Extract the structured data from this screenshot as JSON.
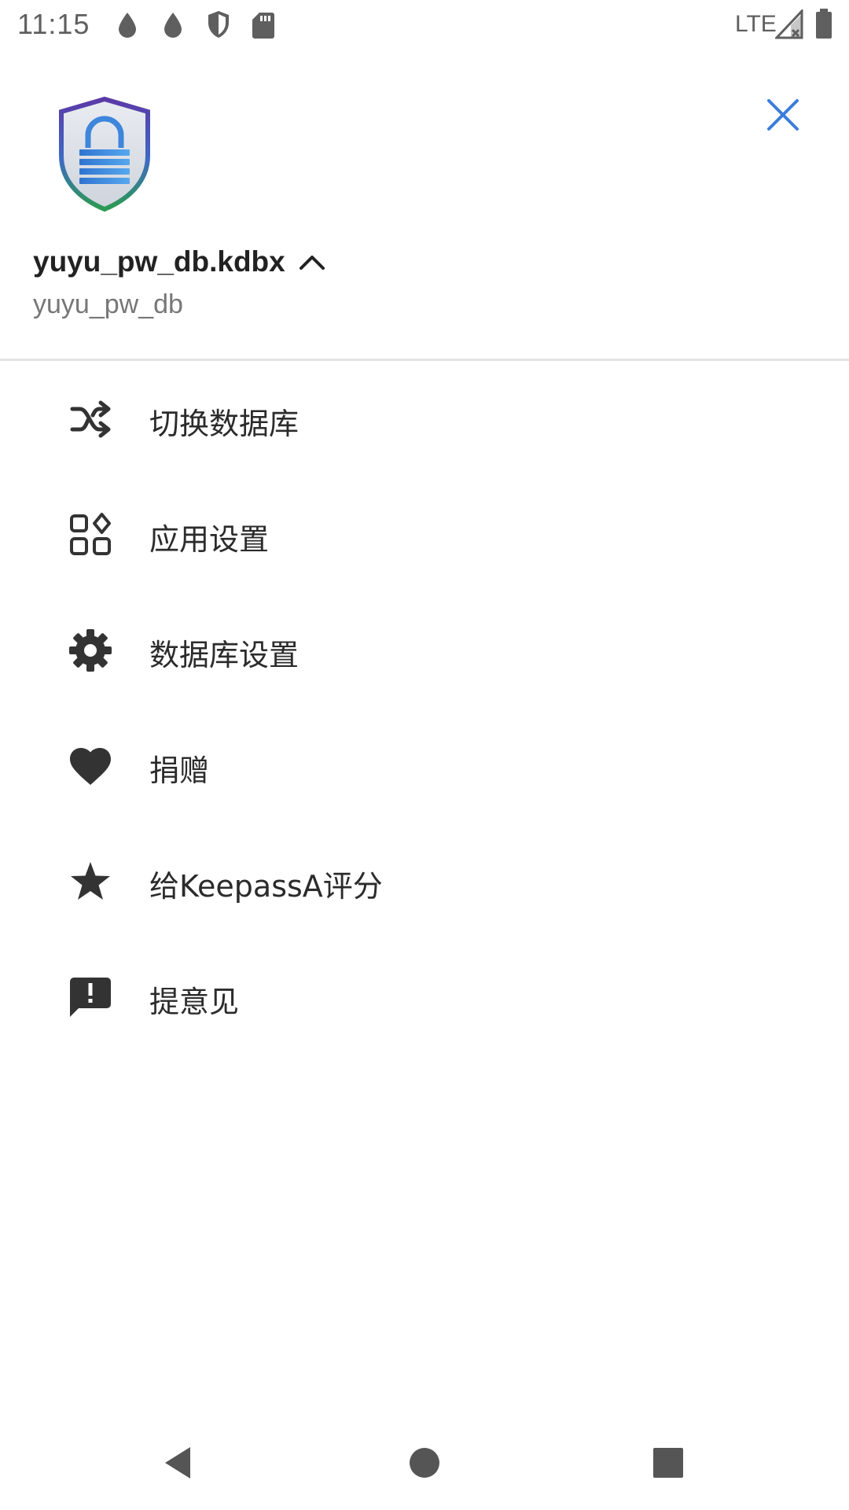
{
  "status_bar": {
    "time": "11:15",
    "network": "LTE",
    "icons": [
      "drop-icon",
      "drop-icon",
      "shield-icon",
      "sd-card-icon",
      "signal-icon",
      "battery-icon"
    ]
  },
  "header": {
    "logo": "keepassa-shield-lock-logo",
    "close_icon": "close-icon",
    "close_color": "#3b7ddd",
    "database_file": "yuyu_pw_db.kdbx",
    "expand_icon": "chevron-up-icon",
    "database_name": "yuyu_pw_db"
  },
  "menu": {
    "items": [
      {
        "icon": "shuffle-icon",
        "label": "切换数据库"
      },
      {
        "icon": "apps-icon",
        "label": "应用设置"
      },
      {
        "icon": "gear-icon",
        "label": "数据库设置"
      },
      {
        "icon": "heart-icon",
        "label": "捐赠"
      },
      {
        "icon": "star-icon",
        "label": "给KeepassA评分"
      },
      {
        "icon": "feedback-icon",
        "label": "提意见"
      }
    ]
  },
  "nav_bar": {
    "back": "back-icon",
    "home": "home-icon",
    "recents": "recents-icon"
  }
}
